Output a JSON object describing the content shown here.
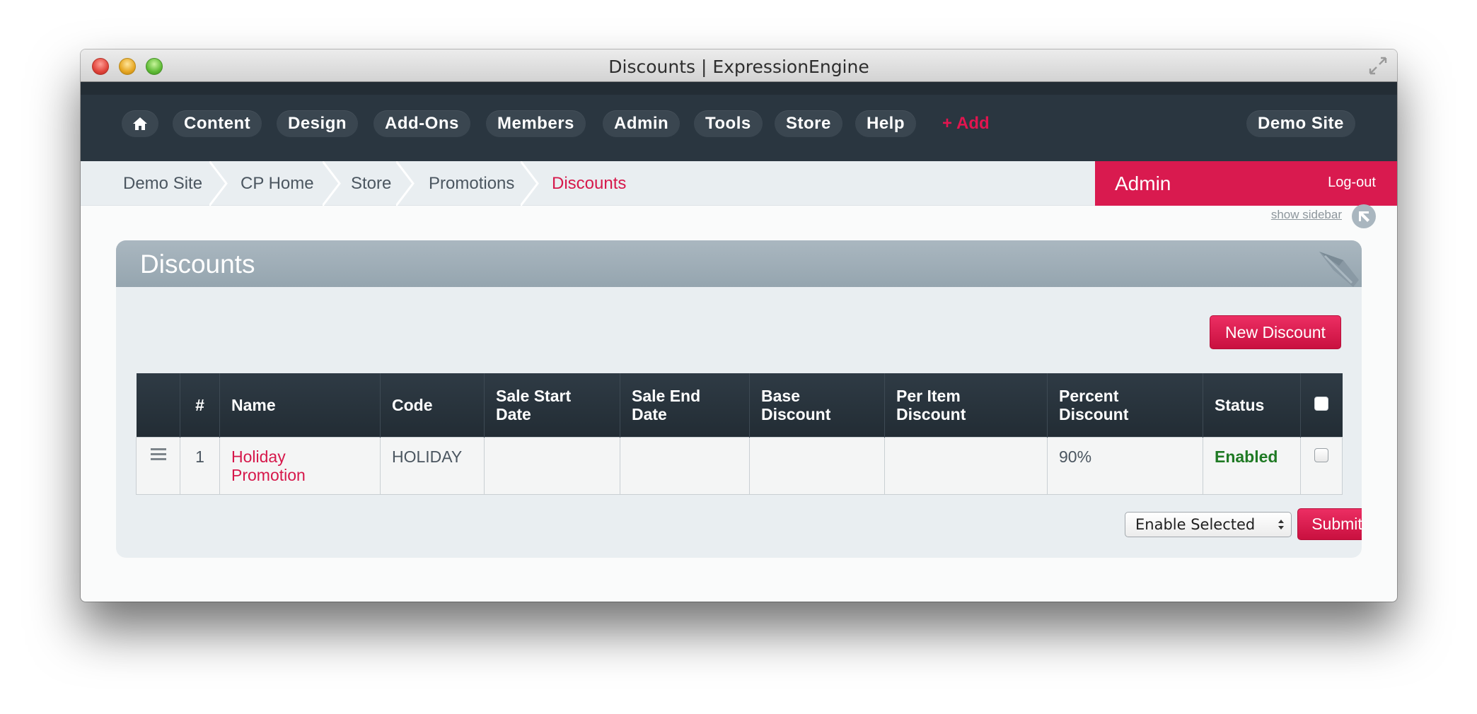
{
  "window": {
    "title": "Discounts | ExpressionEngine"
  },
  "nav": {
    "items": [
      "Content",
      "Design",
      "Add-Ons",
      "Members",
      "Admin",
      "Tools",
      "Store",
      "Help"
    ],
    "add_label": "Add",
    "site_label": "Demo Site"
  },
  "breadcrumb": {
    "items": [
      "Demo Site",
      "CP Home",
      "Store",
      "Promotions"
    ],
    "current": "Discounts"
  },
  "user_bar": {
    "role": "Admin",
    "logout": "Log-out"
  },
  "sidebar_toggle": "show sidebar",
  "panel": {
    "title": "Discounts",
    "new_button": "New Discount"
  },
  "table": {
    "headers": {
      "num": "#",
      "name": "Name",
      "code": "Code",
      "start": [
        "Sale Start",
        "Date"
      ],
      "end": [
        "Sale End",
        "Date"
      ],
      "base": [
        "Base",
        "Discount"
      ],
      "per_item": [
        "Per Item",
        "Discount"
      ],
      "percent": [
        "Percent",
        "Discount"
      ],
      "status": "Status"
    },
    "rows": [
      {
        "num": "1",
        "name": [
          "Holiday",
          "Promotion"
        ],
        "code": "HOLIDAY",
        "start": "",
        "end": "",
        "base": "",
        "per_item": "",
        "percent": "90%",
        "status": "Enabled"
      }
    ]
  },
  "actions": {
    "select_value": "Enable Selected",
    "submit": "Submit"
  },
  "colors": {
    "accent": "#d91a4f",
    "nav_bg": "#2a3640",
    "status_enabled": "#1f7a24"
  }
}
